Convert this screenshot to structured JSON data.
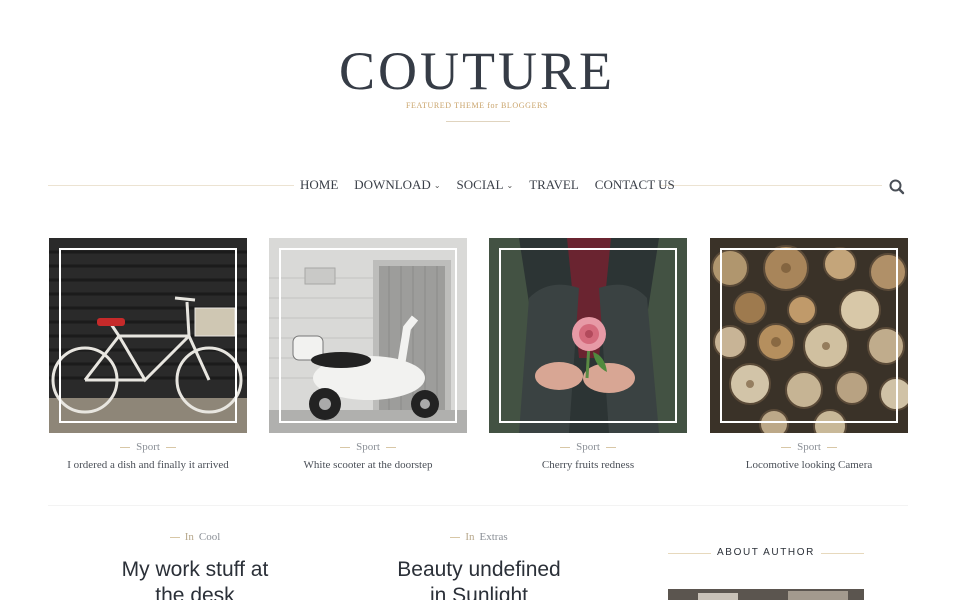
{
  "header": {
    "logo": "COUTURE",
    "tagline": "FEATURED THEME for BLOGGERS"
  },
  "nav": {
    "items": [
      {
        "label": "HOME",
        "dropdown": false
      },
      {
        "label": "DOWNLOAD",
        "dropdown": true
      },
      {
        "label": "SOCIAL",
        "dropdown": true
      },
      {
        "label": "TRAVEL",
        "dropdown": false
      },
      {
        "label": "CONTACT US",
        "dropdown": false
      }
    ],
    "search_icon": "search-icon"
  },
  "featured": [
    {
      "category": "Sport",
      "title": "I ordered a dish and finally it arrived",
      "image": "bicycle-photo"
    },
    {
      "category": "Sport",
      "title": "White scooter at the doorstep",
      "image": "scooter-photo"
    },
    {
      "category": "Sport",
      "title": "Cherry fruits redness",
      "image": "flower-photo"
    },
    {
      "category": "Sport",
      "title": "Locomotive looking Camera",
      "image": "logs-photo"
    }
  ],
  "posts": [
    {
      "prefix": "In",
      "category": "Cool",
      "title_line1": "My work stuff at",
      "title_line2": "the desk"
    },
    {
      "prefix": "In",
      "category": "Extras",
      "title_line1": "Beauty undefined",
      "title_line2": "in Sunlight"
    }
  ],
  "sidebar": {
    "about_title": "ABOUT AUTHOR"
  },
  "colors": {
    "accent": "#c9a36a",
    "text": "#363c46"
  }
}
